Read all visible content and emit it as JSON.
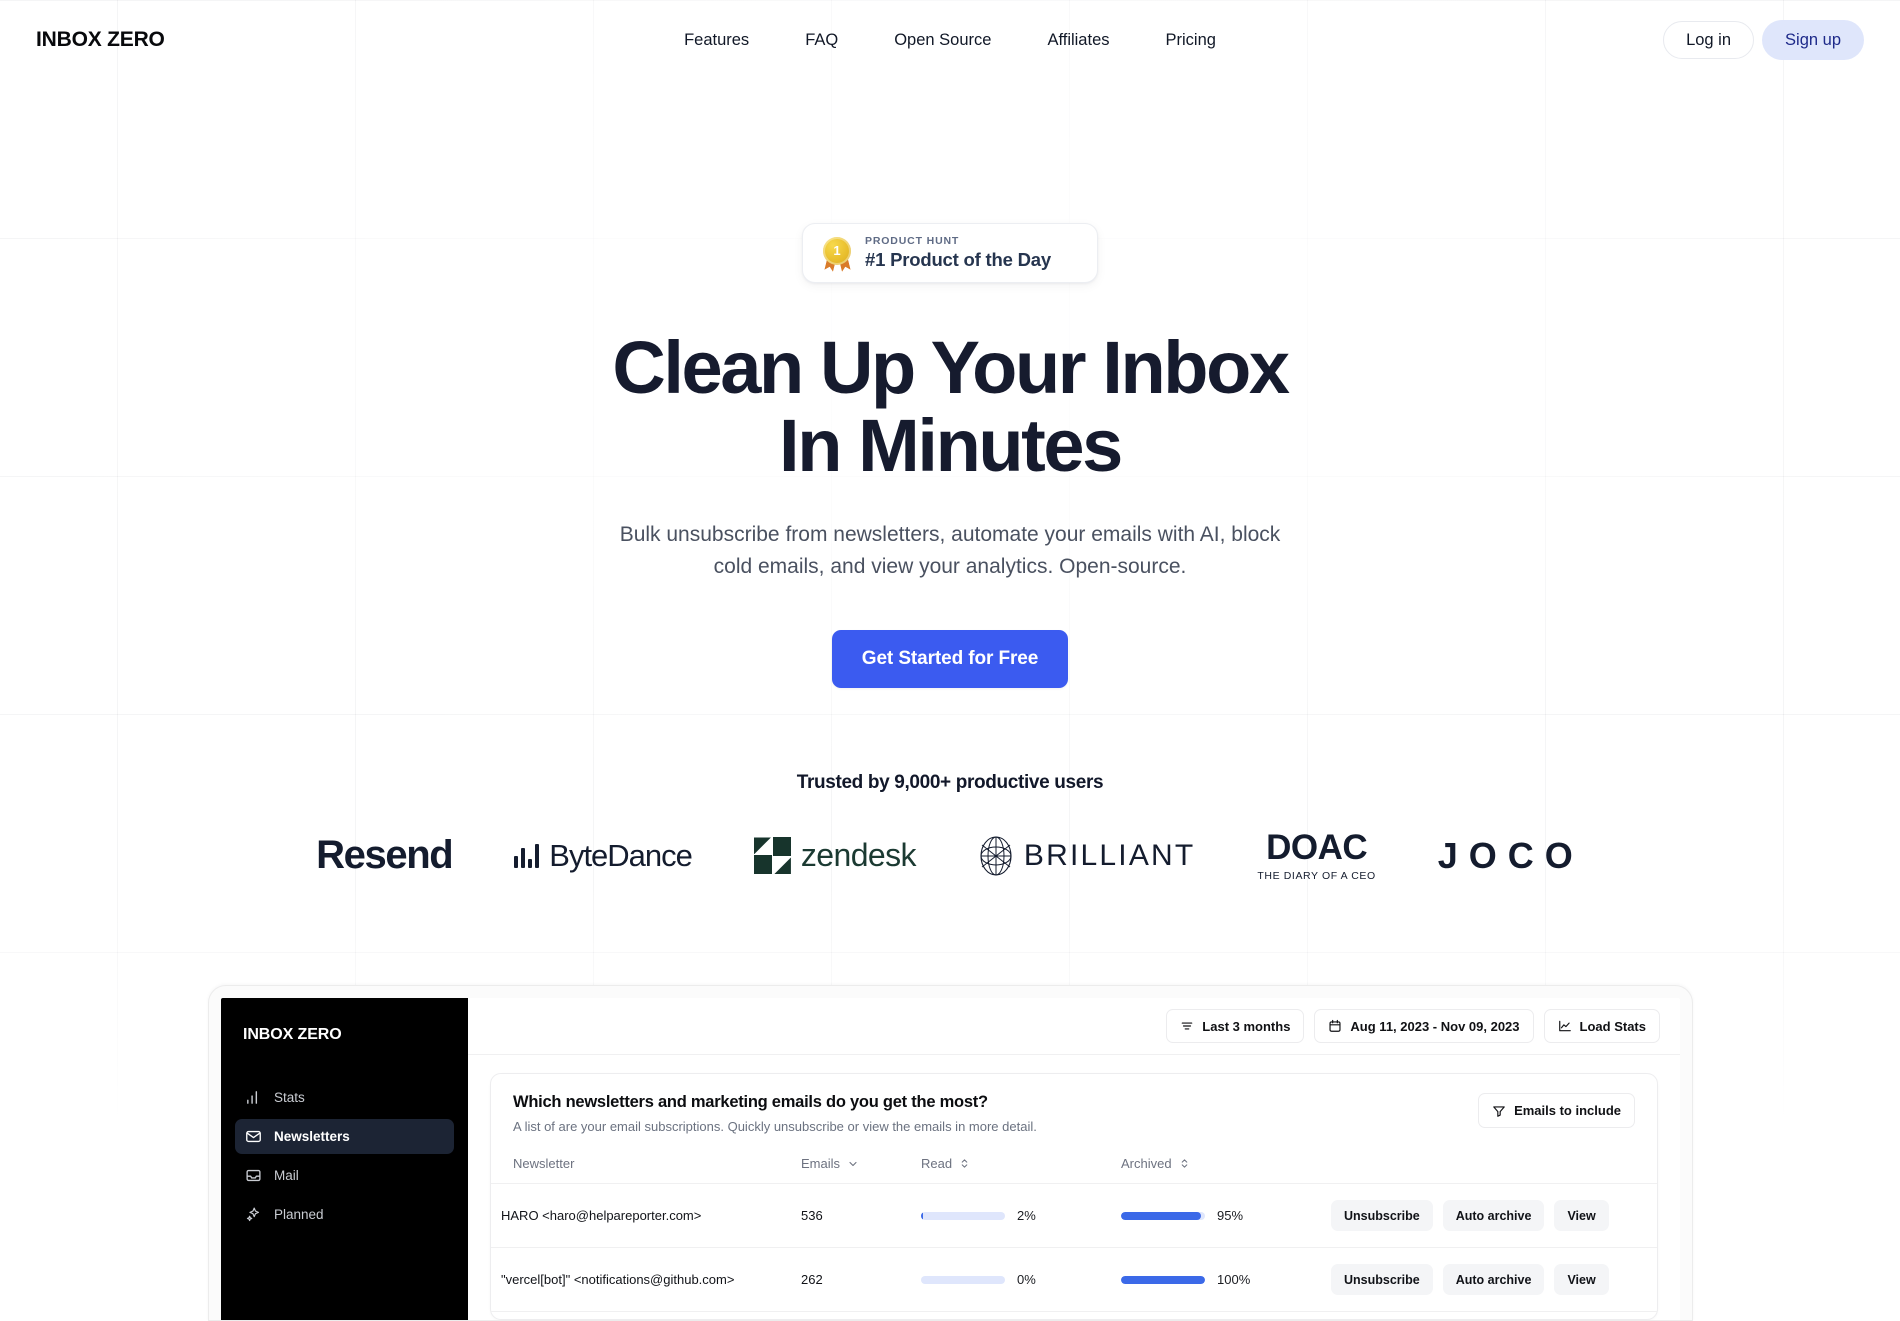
{
  "header": {
    "brand": "INBOX ZERO",
    "links": [
      {
        "label": "Features"
      },
      {
        "label": "FAQ"
      },
      {
        "label": "Open Source"
      },
      {
        "label": "Affiliates"
      },
      {
        "label": "Pricing"
      }
    ],
    "login_label": "Log in",
    "signup_label": "Sign up"
  },
  "hero": {
    "badge": {
      "kicker": "PRODUCT HUNT",
      "title": "#1 Product of the Day",
      "medal_number": "1",
      "icon": "medal-icon"
    },
    "headline_line1": "Clean Up Your Inbox",
    "headline_line2": "In Minutes",
    "subtitle": "Bulk unsubscribe from newsletters, automate your emails with AI, block cold emails, and view your analytics. Open-source.",
    "cta_label": "Get Started for Free"
  },
  "social_proof": {
    "heading": "Trusted by 9,000+ productive users",
    "logos": [
      {
        "name": "Resend"
      },
      {
        "name": "ByteDance"
      },
      {
        "name": "zendesk"
      },
      {
        "name": "BRILLIANT"
      },
      {
        "name": "DOAC",
        "tagline": "THE DIARY OF A CEO"
      },
      {
        "name": "JOCO"
      }
    ]
  },
  "app": {
    "brand": "INBOX ZERO",
    "sidebar": [
      {
        "label": "Stats",
        "icon": "bar-chart-icon",
        "active": false
      },
      {
        "label": "Newsletters",
        "icon": "envelope-icon",
        "active": true
      },
      {
        "label": "Mail",
        "icon": "inbox-icon",
        "active": false
      },
      {
        "label": "Planned",
        "icon": "sparkles-icon",
        "active": false
      }
    ],
    "toolbar": {
      "range_label": "Last 3 months",
      "date_label": "Aug 11, 2023 - Nov 09, 2023",
      "load_stats_label": "Load Stats"
    },
    "card": {
      "title": "Which newsletters and marketing emails do you get the most?",
      "description": "A list of are your email subscriptions. Quickly unsubscribe or view the emails in more detail.",
      "filter_label": "Emails to include",
      "columns": {
        "newsletter": "Newsletter",
        "emails": "Emails",
        "read": "Read",
        "archived": "Archived"
      },
      "rows": [
        {
          "newsletter": "HARO <haro@helpareporter.com>",
          "emails": "536",
          "read_pct": "2%",
          "read_value": 2,
          "archived_pct": "95%",
          "archived_value": 95,
          "unsubscribe_label": "Unsubscribe",
          "auto_archive_label": "Auto archive",
          "view_label": "View"
        },
        {
          "newsletter": "\"vercel[bot]\" <notifications@github.com>",
          "emails": "262",
          "read_pct": "0%",
          "read_value": 0,
          "archived_pct": "100%",
          "archived_value": 100,
          "unsubscribe_label": "Unsubscribe",
          "auto_archive_label": "Auto archive",
          "view_label": "View"
        }
      ]
    }
  },
  "colors": {
    "cta_blue": "#3b5bf0",
    "signup_bg": "#dfe6fb",
    "signup_text": "#1e2a8a",
    "headline": "#161b2e",
    "bar_fill": "#3b69e8",
    "bar_track": "#dfe6fc",
    "sidebar_bg": "#000000",
    "sidebar_active": "#1c2434"
  }
}
